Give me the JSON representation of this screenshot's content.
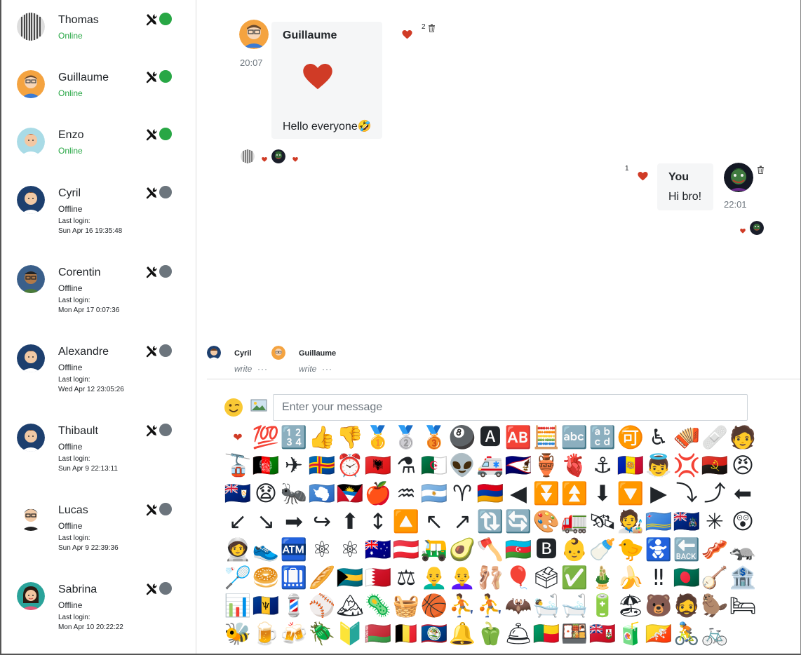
{
  "users": [
    {
      "name": "Thomas",
      "status": "Online",
      "online": true,
      "last_login_label": "",
      "last_login": ""
    },
    {
      "name": "Guillaume",
      "status": "Online",
      "online": true,
      "last_login_label": "",
      "last_login": ""
    },
    {
      "name": "Enzo",
      "status": "Online",
      "online": true,
      "last_login_label": "",
      "last_login": ""
    },
    {
      "name": "Cyril",
      "status": "Offline",
      "online": false,
      "last_login_label": "Last login:",
      "last_login": "Sun Apr 16 19:35:48"
    },
    {
      "name": "Corentin",
      "status": "Offline",
      "online": false,
      "last_login_label": "Last login:",
      "last_login": "Mon Apr 17 0:07:36"
    },
    {
      "name": "Alexandre",
      "status": "Offline",
      "online": false,
      "last_login_label": "Last login:",
      "last_login": "Wed Apr 12 23:05:26"
    },
    {
      "name": "Thibault",
      "status": "Offline",
      "online": false,
      "last_login_label": "Last login:",
      "last_login": "Sun Apr 9 22:13:11"
    },
    {
      "name": "Lucas",
      "status": "Offline",
      "online": false,
      "last_login_label": "Last login:",
      "last_login": "Sun Apr 9 22:39:36"
    },
    {
      "name": "Sabrina",
      "status": "Offline",
      "online": false,
      "last_login_label": "Last login:",
      "last_login": "Mon Apr 10 20:22:22"
    }
  ],
  "messages": [
    {
      "author": "Guillaume",
      "time": "20:07",
      "big_emoji": "❤",
      "text": "Hello everyone🤣",
      "like_count": "2"
    },
    {
      "author": "You",
      "time": "22:01",
      "text": "Hi bro!",
      "like_count": "1"
    }
  ],
  "typing": [
    {
      "name": "Cyril",
      "label": "write",
      "dots": "···"
    },
    {
      "name": "Guillaume",
      "label": "write",
      "dots": "···"
    }
  ],
  "composer": {
    "placeholder": "Enter your message",
    "emoji_button": "😉"
  },
  "colors": {
    "online": "#28a745",
    "offline": "#6c757d",
    "heart": "#d03b26",
    "bubble": "#f5f6f7"
  },
  "emojis": [
    "❤",
    "💯",
    "🔢",
    "👍",
    "👎",
    "🥇",
    "🥈",
    "🥉",
    "🎱",
    "🅰",
    "🆎",
    "🧮",
    "🔤",
    "🔡",
    "🉑",
    "♿",
    "🪗",
    "🩹",
    "🧑",
    "🚡",
    "🇦🇫",
    "✈",
    "🇦🇽",
    "⏰",
    "🇦🇱",
    "⚗",
    "🇩🇿",
    "👽",
    "🚑",
    "🇦🇸",
    "🏺",
    "🫀",
    "⚓",
    "🇦🇩",
    "👼",
    "💢",
    "🇦🇴",
    "😠",
    "🇦🇮",
    "😧",
    "🐜",
    "🇦🇶",
    "🇦🇬",
    "🍎",
    "♒",
    "🇦🇷",
    "♈",
    "🇦🇲",
    "◀",
    "⏬",
    "⏫",
    "⬇",
    "🔽",
    "▶",
    "⤵",
    "⤴",
    "⬅",
    "↙",
    "↘",
    "➡",
    "↪",
    "⬆",
    "↕",
    "🔼",
    "↖",
    "↗",
    "🔃",
    "🔄",
    "🎨",
    "🚛",
    "🛰",
    "🧑‍🎨",
    "🇦🇼",
    "🇦🇨",
    "✳",
    "😲",
    "🧑‍🚀",
    "👟",
    "🏧",
    "⚛",
    "⚛",
    "🇦🇺",
    "🇦🇹",
    "🛺",
    "🥑",
    "🪓",
    "🇦🇿",
    "🅱",
    "👶",
    "🍼",
    "🐤",
    "🚼",
    "🔙",
    "🥓",
    "🦡",
    "🏸",
    "🥯",
    "🛄",
    "🥖",
    "🇧🇸",
    "🇧🇭",
    "⚖",
    "👨‍🦲",
    "👩‍🦲",
    "🩰",
    "🎈",
    "🗳",
    "✅",
    "🎍",
    "🍌",
    "‼",
    "🇧🇩",
    "🪕",
    "🏦",
    "📊",
    "🇧🇧",
    "💈",
    "⚾",
    "🏔",
    "🦠",
    "🧺",
    "🏀",
    "⛹",
    "⛹",
    "🦇",
    "🛀",
    "🛁",
    "🔋",
    "🏖",
    "🐻",
    "🧔",
    "🦫",
    "🛏",
    "🐝",
    "🍺",
    "🍻",
    "🪲",
    "🔰",
    "🇧🇾",
    "🇧🇪",
    "🇧🇿",
    "🔔",
    "🫑",
    "🛎",
    "🇧🇯",
    "🍱",
    "🇧🇲",
    "🧃",
    "🇧🇹",
    "🚴",
    "🚲"
  ]
}
